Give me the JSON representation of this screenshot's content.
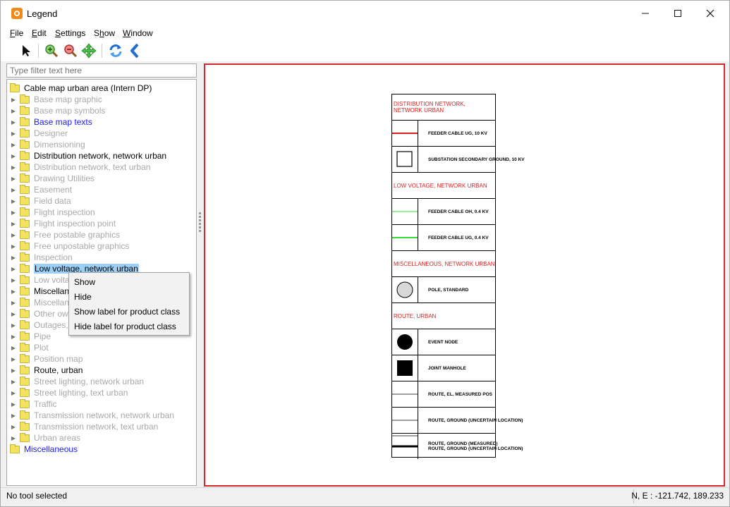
{
  "window": {
    "title": "Legend",
    "app_icon": "app-logo-icon",
    "controls": [
      "minimize-icon",
      "maximize-icon",
      "close-icon"
    ]
  },
  "menubar": {
    "items": [
      {
        "label": "File",
        "accel": "F"
      },
      {
        "label": "Edit",
        "accel": "E"
      },
      {
        "label": "Settings",
        "accel": "S"
      },
      {
        "label": "Show",
        "accel": "S"
      },
      {
        "label": "Window",
        "accel": "W"
      }
    ]
  },
  "toolbar": {
    "tools": [
      "select-arrow-icon",
      "zoom-in-icon",
      "zoom-out-icon",
      "pan-icon",
      "refresh-icon",
      "back-icon"
    ]
  },
  "filter": {
    "placeholder": "Type filter text here"
  },
  "tree": {
    "root": "Cable map urban area (Intern DP)",
    "items": [
      {
        "label": "Base map graphic",
        "style": "gray"
      },
      {
        "label": "Base map symbols",
        "style": "gray"
      },
      {
        "label": "Base map texts",
        "style": "blue"
      },
      {
        "label": "Designer",
        "style": "gray"
      },
      {
        "label": "Dimensioning",
        "style": "gray"
      },
      {
        "label": "Distribution network, network urban",
        "style": "black"
      },
      {
        "label": "Distribution network, text urban",
        "style": "gray"
      },
      {
        "label": "Drawing Utilities",
        "style": "gray"
      },
      {
        "label": "Easement",
        "style": "gray"
      },
      {
        "label": "Field data",
        "style": "gray"
      },
      {
        "label": "Flight inspection",
        "style": "gray"
      },
      {
        "label": "Flight inspection point",
        "style": "gray"
      },
      {
        "label": "Free postable graphics",
        "style": "gray"
      },
      {
        "label": "Free unpostable graphics",
        "style": "gray"
      },
      {
        "label": "Inspection",
        "style": "gray"
      },
      {
        "label": "Low voltage, network urban",
        "style": "selected"
      },
      {
        "label": "Low volta",
        "style": "gray"
      },
      {
        "label": "Miscellan",
        "style": "black"
      },
      {
        "label": "Miscellan",
        "style": "gray"
      },
      {
        "label": "Other ow",
        "style": "gray"
      },
      {
        "label": "Outages,",
        "style": "gray"
      },
      {
        "label": "Pipe",
        "style": "gray"
      },
      {
        "label": "Plot",
        "style": "gray"
      },
      {
        "label": "Position map",
        "style": "gray"
      },
      {
        "label": "Route, urban",
        "style": "black"
      },
      {
        "label": "Street lighting, network urban",
        "style": "gray"
      },
      {
        "label": "Street lighting, text urban",
        "style": "gray"
      },
      {
        "label": "Traffic",
        "style": "gray"
      },
      {
        "label": "Transmission network, network urban",
        "style": "gray"
      },
      {
        "label": "Transmission network, text urban",
        "style": "gray"
      },
      {
        "label": "Urban areas",
        "style": "gray"
      }
    ],
    "bottom": "Miscellaneous"
  },
  "context_menu": {
    "items": [
      "Show",
      "Hide",
      "Show label for product class",
      "Hide label for product class"
    ]
  },
  "legend": {
    "rows": [
      {
        "kind": "header",
        "text": "DISTRIBUTION NETWORK, NETWORK URBAN"
      },
      {
        "kind": "item",
        "symbol": "red-line",
        "text": "FEEDER CABLE UG, 10 KV"
      },
      {
        "kind": "item",
        "symbol": "square-outline",
        "text": "SUBSTATION SECONDARY GROUND, 10 KV"
      },
      {
        "kind": "header",
        "text": "LOW VOLTAGE, NETWORK URBAN"
      },
      {
        "kind": "item",
        "symbol": "green-thin-line",
        "text": "FEEDER CABLE OH, 0.4 KV"
      },
      {
        "kind": "item",
        "symbol": "green-line",
        "text": "FEEDER CABLE UG, 0.4 KV"
      },
      {
        "kind": "header",
        "text": "MISCELLANEOUS, NETWORK URBAN"
      },
      {
        "kind": "item",
        "symbol": "gray-circle",
        "text": "POLE, STANDARD"
      },
      {
        "kind": "header",
        "text": "ROUTE, URBAN"
      },
      {
        "kind": "item",
        "symbol": "black-circle",
        "text": "EVENT NODE"
      },
      {
        "kind": "item",
        "symbol": "black-square",
        "text": "JOINT MANHOLE"
      },
      {
        "kind": "item",
        "symbol": "thin-black-line",
        "text": "ROUTE, EL. MEASURED POS"
      },
      {
        "kind": "item",
        "symbol": "thin-black-line",
        "text": "ROUTE, GROUND  (UNCERTAIN LOCATION)"
      },
      {
        "kind": "item",
        "symbol": "double-line",
        "text": "ROUTE, GROUND (MEASURED)",
        "text2": "ROUTE, GROUND  (UNCERTAIN LOCATION)"
      }
    ],
    "colors": {
      "header": "#e02020",
      "red_line": "#d42020",
      "green_line": "#33dd33",
      "circle_fill": "#d8d8d8"
    }
  },
  "status": {
    "left": "No tool selected",
    "right": "N, E : -121.742, 189.233"
  }
}
